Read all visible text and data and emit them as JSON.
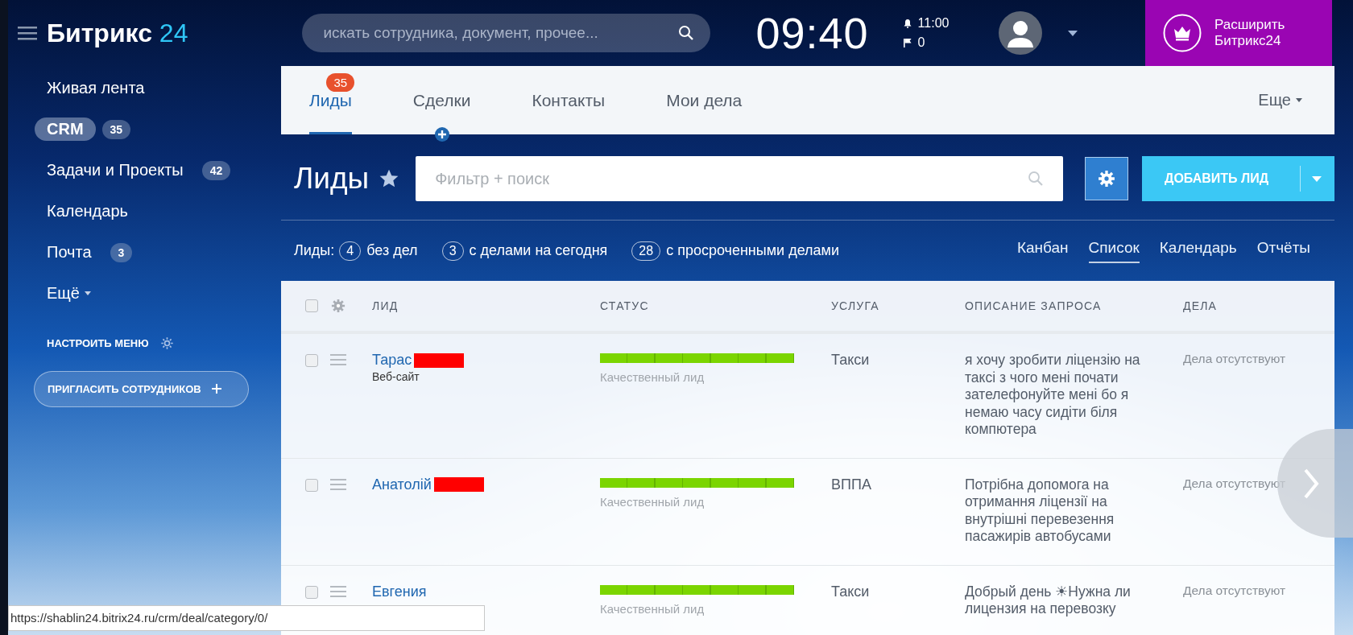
{
  "header": {
    "logo": {
      "name": "Битрикс",
      "number": "24"
    },
    "search": {
      "placeholder": "искать сотрудника, документ, прочее..."
    },
    "clock": "09:40",
    "alarm_time": "11:00",
    "flag_count": "0",
    "upgrade_button": {
      "line1": "Расширить",
      "line2": "Битрикс24"
    }
  },
  "sidebar": {
    "items": [
      {
        "label": "Живая лента",
        "selected": false,
        "kind": "item"
      },
      {
        "label": "CRM",
        "count": "35",
        "selected": true,
        "kind": "item"
      },
      {
        "label": "Задачи и Проекты",
        "count": "42",
        "selected": false,
        "kind": "item"
      },
      {
        "label": "Календарь",
        "selected": false,
        "kind": "item"
      },
      {
        "label": "Почта",
        "count": "3",
        "selected": false,
        "kind": "item"
      },
      {
        "label": "Ещё",
        "selected": false,
        "kind": "more"
      }
    ],
    "configure_menu": "НАСТРОИТЬ МЕНЮ",
    "invite_button": "ПРИГЛАСИТЬ СОТРУДНИКОВ"
  },
  "tabs": [
    {
      "label": "Лиды",
      "selected": true,
      "badge": "35",
      "plus": false
    },
    {
      "label": "Сделки",
      "selected": false,
      "plus": true
    },
    {
      "label": "Контакты",
      "selected": false,
      "plus": false
    },
    {
      "label": "Мои дела",
      "selected": false,
      "plus": false
    }
  ],
  "more_tab": "Еще",
  "page_title": "Лиды",
  "filter": {
    "placeholder": "Фильтр + поиск"
  },
  "add_button": "ДОБАВИТЬ ЛИД",
  "counters": {
    "label": "Лиды:",
    "items": [
      {
        "count": "4",
        "text": "без дел"
      },
      {
        "count": "3",
        "text": "с делами на сегодня"
      },
      {
        "count": "28",
        "text": "с просроченными делами"
      }
    ]
  },
  "views": [
    {
      "label": "Канбан",
      "selected": false
    },
    {
      "label": "Список",
      "selected": true
    },
    {
      "label": "Календарь",
      "selected": false
    },
    {
      "label": "Отчёты",
      "selected": false
    }
  ],
  "table": {
    "columns": [
      "ЛИД",
      "СТАТУС",
      "УСЛУГА",
      "ОПИСАНИЕ ЗАПРОСА",
      "ДЕЛА"
    ],
    "header_checked": false,
    "rows": [
      {
        "checked": false,
        "name": "Тарас",
        "redacted": true,
        "source": "Веб-сайт",
        "status": "Качественный лид",
        "level": 1,
        "service": "Такси",
        "description": "я хочу зробити ліцензію на таксі з чого мені почати зателефонуйте мені бо я немаю часу сидіти біля компютера",
        "activities": "Дела отсутствуют"
      },
      {
        "checked": false,
        "name": "Анатолій",
        "redacted": true,
        "status": "Качественный лид",
        "level": 1,
        "service": "ВППА",
        "description": "Потрібна допомога на отримання ліцензії на внутрішні перевезення пасажирів автобусами",
        "activities": "Дела отсутствуют"
      },
      {
        "checked": false,
        "name": "Евгения",
        "redacted": false,
        "status": "Качественный лид",
        "level": 1,
        "service": "Такси",
        "description": "Добрый день ☀Нужна ли лицензия на перевозку",
        "activities": "Дела отсутствуют"
      }
    ]
  },
  "status_url": "https://shablin24.bitrix24.ru/crm/deal/category/0/"
}
